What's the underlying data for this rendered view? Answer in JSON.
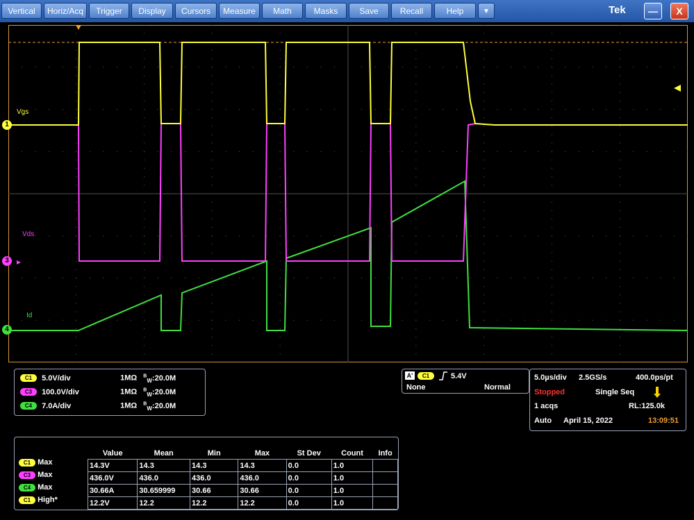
{
  "menubar": {
    "items": [
      "Vertical",
      "Horiz/Acq",
      "Trigger",
      "Display",
      "Cursors",
      "Measure",
      "Math",
      "Masks",
      "Save",
      "Recall",
      "Help"
    ],
    "dropdown_glyph": "▼",
    "brand": "Tek",
    "minimize_glyph": "—",
    "close_glyph": "X"
  },
  "colors": {
    "ch1": "#ffff3c",
    "ch3": "#ff40ff",
    "ch4": "#40e040",
    "orange": "#f0a030"
  },
  "icons": [
    "trigger-position-icon",
    "trigger-level-arrow-icon",
    "channel-marker-icon",
    "edge-rising-icon",
    "acq-status-icon"
  ],
  "waveform": {
    "ch1_label": "Vgs",
    "ch3_label": "Vds",
    "ch4_label": "Id",
    "markers": {
      "ch1": "1",
      "ch3": "3",
      "ch4": "4"
    }
  },
  "channels": [
    {
      "chip": "C1",
      "scale": "5.0V/div",
      "imp": "1MΩ",
      "bw_sup": "B",
      "bw_sub": "W",
      "bw": ":20.0M"
    },
    {
      "chip": "C3",
      "scale": "100.0V/div",
      "imp": "1MΩ",
      "bw_sup": "B",
      "bw_sub": "W",
      "bw": ":20.0M"
    },
    {
      "chip": "C4",
      "scale": "7.0A/div",
      "imp": "1MΩ",
      "bw_sup": "B",
      "bw_sub": "W",
      "bw": ":20.0M"
    }
  ],
  "trigger": {
    "a_chip": "A'",
    "source_chip": "C1",
    "level": "5.4V",
    "coupling": "None",
    "mode": "Normal"
  },
  "acquisition": {
    "timebase": "5.0µs/div",
    "sample_rate": "2.5GS/s",
    "resolution": "400.0ps/pt",
    "state": "Stopped",
    "mode": "Single Seq",
    "acqs": "1 acqs",
    "record_length": "RL:125.0k",
    "trigger_mode": "Auto",
    "date": "April 15, 2022",
    "time": "13:09:51"
  },
  "measurements": {
    "headers": [
      "Value",
      "Mean",
      "Min",
      "Max",
      "St Dev",
      "Count",
      "Info"
    ],
    "rows": [
      {
        "chip": "C1",
        "type": "Max",
        "value": "14.3V",
        "mean": "14.3",
        "min": "14.3",
        "max": "14.3",
        "stdev": "0.0",
        "count": "1.0",
        "info": ""
      },
      {
        "chip": "C3",
        "type": "Max",
        "value": "436.0V",
        "mean": "436.0",
        "min": "436.0",
        "max": "436.0",
        "stdev": "0.0",
        "count": "1.0",
        "info": ""
      },
      {
        "chip": "C4",
        "type": "Max",
        "value": "30.66A",
        "mean": "30.659999",
        "min": "30.66",
        "max": "30.66",
        "stdev": "0.0",
        "count": "1.0",
        "info": ""
      },
      {
        "chip": "C1",
        "type": "High*",
        "value": "12.2V",
        "mean": "12.2",
        "min": "12.2",
        "max": "12.2",
        "stdev": "0.0",
        "count": "1.0",
        "info": ""
      }
    ]
  }
}
